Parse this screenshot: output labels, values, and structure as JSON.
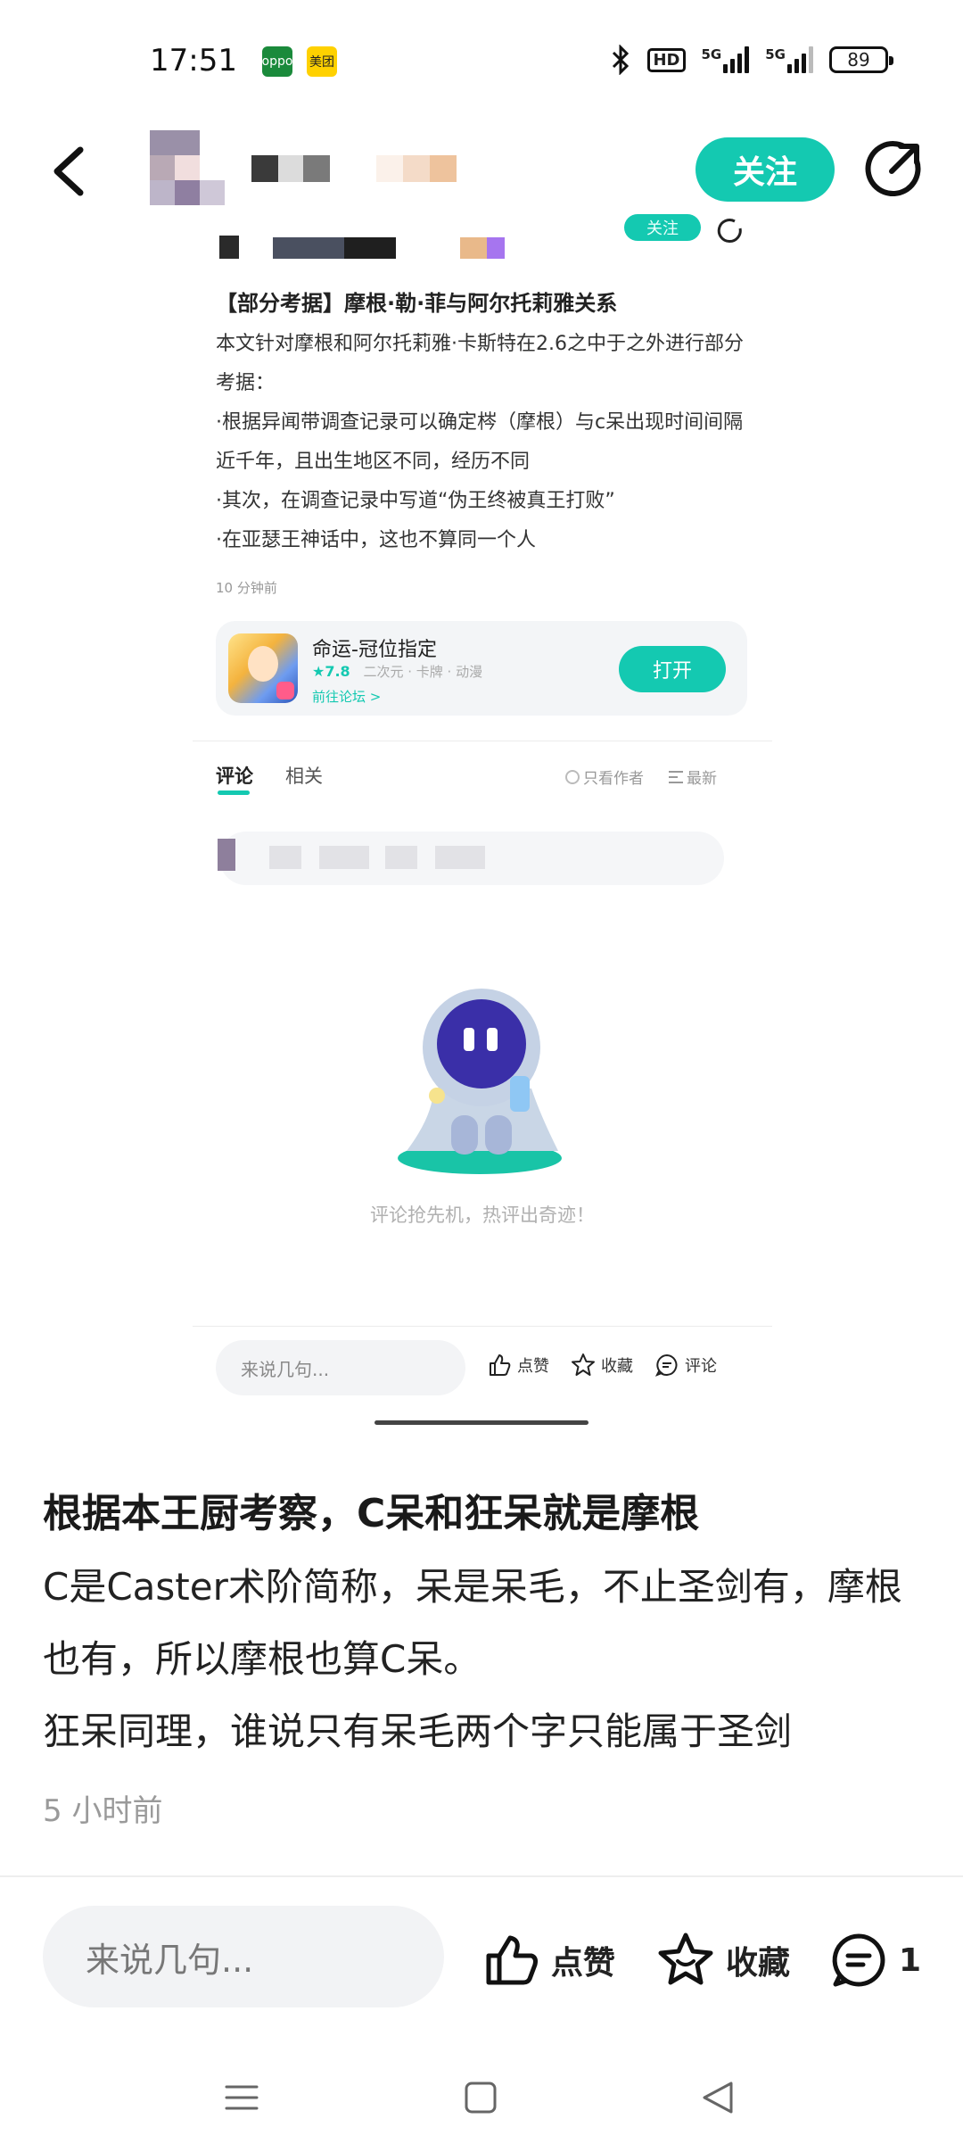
{
  "status_bar": {
    "time": "17:51",
    "app_badges": [
      "oppo",
      "美团"
    ],
    "hd_label": "HD",
    "network_1": "5G",
    "network_2": "5G",
    "battery": "89"
  },
  "top_nav": {
    "follow_label": "关注"
  },
  "embedded_screenshot": {
    "header_follow_label": "关注",
    "post_title": "【部分考据】摩根·勒·菲与阿尔托莉雅关系",
    "post_paragraphs": [
      "本文针对摩根和阿尔托莉雅·卡斯特在2.6之中于之外进行部分考据：",
      "·根据异闻带调查记录可以确定梣（摩根）与c呆出现时间间隔近千年，且出生地区不同，经历不同",
      "·其次，在调查记录中写道“伪王终被真王打败”",
      "·在亚瑟王神话中，这也不算同一个人"
    ],
    "post_time": "10 分钟前",
    "app_card": {
      "name": "命运-冠位指定",
      "rating": "★7.8",
      "tags": "二次元 · 卡牌 · 动漫",
      "forum_link": "前往论坛 >",
      "open_label": "打开"
    },
    "tabs": [
      {
        "label": "评论",
        "active": true
      },
      {
        "label": "相关",
        "active": false
      }
    ],
    "only_author_label": "只看作者",
    "sort_label": "最新",
    "empty_message": "评论抢先机，热评出奇迹！",
    "input_placeholder": "来说几句...",
    "actions": {
      "like": "点赞",
      "favorite": "收藏",
      "comment": "评论"
    }
  },
  "comment": {
    "title": "根据本王厨考察，C呆和狂呆就是摩根",
    "body": [
      "C是Caster术阶简称，呆是呆毛，不止圣剑有，摩根也有，所以摩根也算C呆。",
      "狂呆同理，谁说只有呆毛两个字只能属于圣剑"
    ],
    "time": "5 小时前"
  },
  "bottom_bar": {
    "input_placeholder": "来说几句...",
    "like_label": "点赞",
    "favorite_label": "收藏",
    "comment_count": "1"
  },
  "colors": {
    "accent": "#14c9b1",
    "text_primary": "#1f1f1f",
    "text_muted": "#9a9a9a",
    "input_bg": "#f2f3f5"
  },
  "icons": [
    "back-arrow-icon",
    "share-icon",
    "like-icon",
    "star-icon",
    "comment-icon",
    "menu-icon",
    "home-icon",
    "back-triangle-icon"
  ]
}
